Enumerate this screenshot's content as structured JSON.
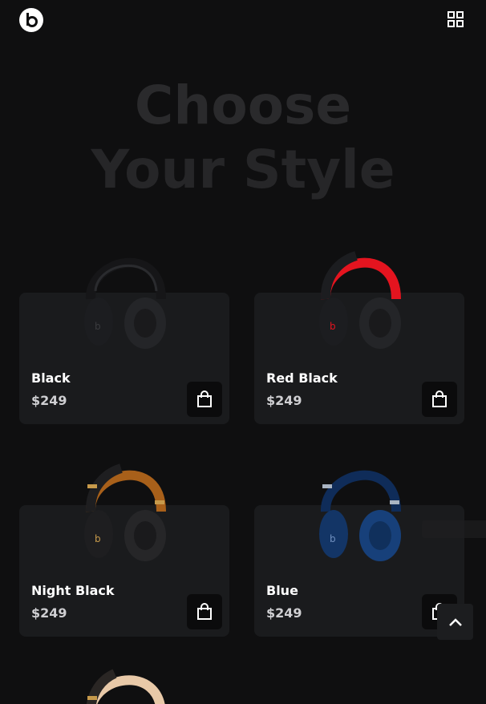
{
  "brand": {
    "logo_icon": "beats-logo-icon"
  },
  "header": {
    "menu_icon": "grid-icon"
  },
  "hero": {
    "line1": "Choose",
    "line2": "Your Style"
  },
  "products": [
    {
      "name": "Black",
      "price": "$249",
      "colors": {
        "band": "#161618",
        "accent": "#2a2b2e",
        "cup": "#1c1d20"
      }
    },
    {
      "name": "Red Black",
      "price": "$249",
      "colors": {
        "band": "#e4141f",
        "accent": "#e4141f",
        "cup": "#1c1d20"
      }
    },
    {
      "name": "Night Black",
      "price": "$249",
      "colors": {
        "band": "#a8601a",
        "accent": "#c79a4b",
        "cup": "#1e1e20"
      }
    },
    {
      "name": "Blue",
      "price": "$249",
      "colors": {
        "band": "#0f2c59",
        "accent": "#a9b4c2",
        "cup": "#133566"
      }
    }
  ],
  "scroll_top_icon": "chevron-up-icon",
  "cart_icon": "shopping-bag-icon"
}
